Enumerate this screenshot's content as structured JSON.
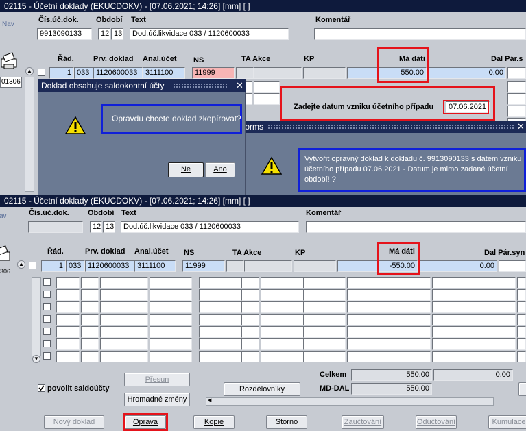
{
  "window_title_top": "02115 - Účetní doklady (EKUCDOKV) - [07.06.2021; 14:26]  [mm]  [ ]",
  "window_title_bottom": "02115 - Účetní doklady (EKUCDOKV) - [07.06.2021; 14:26]  [mm]  [ ]",
  "toolbar": {
    "nav_label": "Nav",
    "doc_label_top": "01306",
    "doc_label_bottom": "306"
  },
  "header": {
    "cis_label": "Čís.úč.dok.",
    "obdobi_label": "Období",
    "text_label": "Text",
    "komentar_label": "Komentář",
    "top": {
      "cis_value": "9913090133",
      "obdobi_1": "12",
      "obdobi_2": "13",
      "text_value": "Dod.úč.likvidace 033 / 1120600033"
    },
    "bottom": {
      "cis_value": "",
      "obdobi_1": "12",
      "obdobi_2": "13",
      "text_value": "Dod.úč.likvidace 033 / 1120600033"
    }
  },
  "columns": {
    "rad": "Řád.",
    "prv": "Prv. doklad",
    "anal": "Anal.účet",
    "ns": "NS",
    "ta": "TA Akce",
    "kp": "KP",
    "madati": "Má dáti",
    "dal_top": "Dal Pár.s",
    "dal_bottom": "Dal Pár.syn"
  },
  "row_top": {
    "num": "1",
    "code": "033",
    "prv": "1120600033",
    "anal": "3111100",
    "ns": "11999",
    "madati": "550.00",
    "dal": "0.00"
  },
  "row_bottom": {
    "num": "1",
    "code": "033",
    "prv": "1120600033",
    "anal": "3111100",
    "ns": "11999",
    "madati": "-550.00",
    "dal": "0.00"
  },
  "dialog_date": {
    "label": "Zadejte datum vzniku účetního případu",
    "value": "07.06.2021"
  },
  "dialog_saldo": {
    "title": "Doklad obsahuje saldokontní účty",
    "message": "Opravdu chcete doklad zkopírovat?",
    "no_label": "Ne",
    "yes_label": "Ano"
  },
  "dialog_forms": {
    "title": "Forms",
    "message": "Vytvořit opravný doklad k dokladu č. 9913090133 s datem vzniku účetního případu 07.06.2021 - Datum je mimo zadané účetní období! ?"
  },
  "footer": {
    "povolit_label": "povolit saldoúčty",
    "presun_label": "Přesun",
    "hromadne_label": "Hromadné změny",
    "rozdelovniky_label": "Rozdělovníky",
    "celkem_label": "Celkem",
    "celkem_value": "550.00",
    "celkem_value2": "0.00",
    "mddal_label": "MD-DAL",
    "mddal_value": "550.00"
  },
  "buttons": {
    "novy": "Nový doklad",
    "oprava": "Oprava",
    "kopie": "Kopie",
    "storno": "Storno",
    "zauctovani": "Zaúčtování",
    "oductovani": "Odúčtování",
    "kumulace": "Kumulace"
  },
  "colors": {
    "title_bar": "#0e1a3c",
    "highlight_red": "#e5131b",
    "highlight_blue": "#1020d8",
    "dialog_bg": "#6b7a93"
  }
}
